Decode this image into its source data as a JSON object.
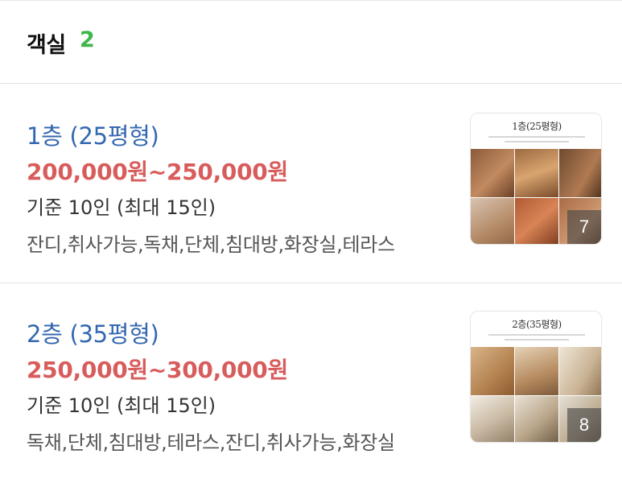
{
  "header": {
    "title": "객실",
    "count": "2"
  },
  "rooms": [
    {
      "name": "1층 (25평형)",
      "price": "200,000원~250,000원",
      "capacity": "기준 10인 (최대 15인)",
      "tags": "잔디,취사가능,독채,단체,침대방,화장실,테라스",
      "thumbnail_title": "1층(25평형)",
      "photo_count": "7"
    },
    {
      "name": "2층 (35평형)",
      "price": "250,000원~300,000원",
      "capacity": "기준 10인 (최대 15인)",
      "tags": "독채,단체,침대방,테라스,잔디,취사가능,화장실",
      "thumbnail_title": "2층(35평형)",
      "photo_count": "8"
    }
  ],
  "colors": {
    "count_green": "#3fb64a",
    "room_name_blue": "#3468b0",
    "price_red": "#d85c5c"
  }
}
